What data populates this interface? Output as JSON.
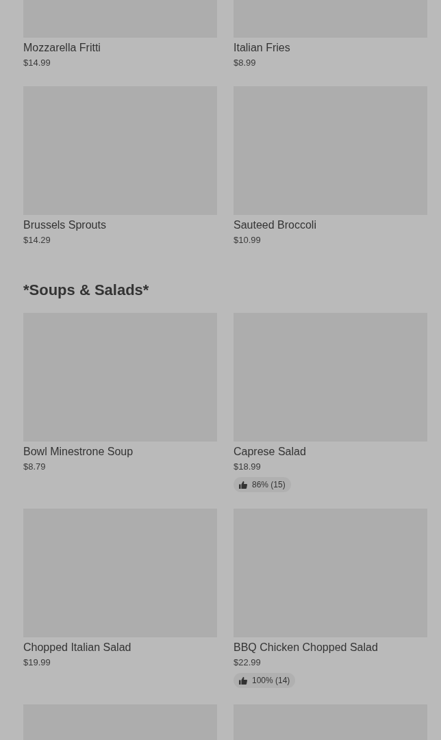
{
  "sections": [
    {
      "items": [
        {
          "name": "Mozzarella Fritti",
          "price": "$14.99"
        },
        {
          "name": "Italian Fries",
          "price": "$8.99"
        },
        {
          "name": "Brussels Sprouts",
          "price": "$14.29"
        },
        {
          "name": "Sauteed Broccoli",
          "price": "$10.99"
        }
      ]
    },
    {
      "heading": "*Soups & Salads*",
      "items": [
        {
          "name": "Bowl Minestrone Soup",
          "price": "$8.79"
        },
        {
          "name": "Caprese Salad",
          "price": "$18.99",
          "rating": "86% (15)"
        },
        {
          "name": "Chopped Italian Salad",
          "price": "$19.99"
        },
        {
          "name": "BBQ Chicken Chopped Salad",
          "price": "$22.99",
          "rating": "100% (14)"
        },
        {
          "kind": "image_only"
        },
        {
          "kind": "image_only"
        }
      ]
    }
  ]
}
